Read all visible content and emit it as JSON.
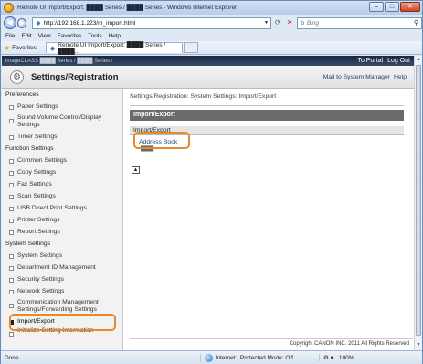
{
  "browser": {
    "title": "Remote UI Import/Export: ████ Series / ████ Series - Windows Internet Explorer",
    "url": "http://192.168.1.223/m_import.html",
    "search_placeholder": "Bing",
    "menu": [
      "File",
      "Edit",
      "View",
      "Favorites",
      "Tools",
      "Help"
    ],
    "favorites_label": "Favorites",
    "tab_title": "Remote UI Import/Export: ████ Series / ████...",
    "status_text": "Done",
    "zone_text": "Internet | Protected Mode: Off",
    "zoom_text": "100%"
  },
  "device": {
    "model_text": "imageCLASS ████ Series / ████ Series /",
    "to_portal": "To Portal",
    "log_out": "Log Out"
  },
  "header": {
    "title": "Settings/Registration",
    "mail_link": "Mail to System Manager",
    "help_link": "Help"
  },
  "sidebar": {
    "groups": [
      {
        "title": "Preferences",
        "items": [
          "Paper Settings",
          "Sound Volume Control/Display Settings",
          "Timer Settings"
        ]
      },
      {
        "title": "Function Settings",
        "items": [
          "Common Settings",
          "Copy Settings",
          "Fax Settings",
          "Scan Settings",
          "USB Direct Print Settings",
          "Printer Settings",
          "Report Settings"
        ]
      },
      {
        "title": "System Settings",
        "items": [
          "System Settings",
          "Department ID Management",
          "Security Settings",
          "Network Settings",
          "Communication Management Settings/Forwarding Settings",
          "Import/Export",
          "Initialize Setting Information"
        ]
      }
    ]
  },
  "main": {
    "breadcrumb": "Settings/Registration: System Settings: Import/Export",
    "page_title": "Import/Export",
    "section_title": "Import/Export",
    "address_book_link": "Address Book",
    "address_book_sub": "████",
    "copyright": "Copyright CANON INC. 2011 All Rights Reserved"
  },
  "colors": {
    "highlight": "#e8892b",
    "link": "#1f3f7a",
    "page_header_bg": "#6a6a6a"
  }
}
